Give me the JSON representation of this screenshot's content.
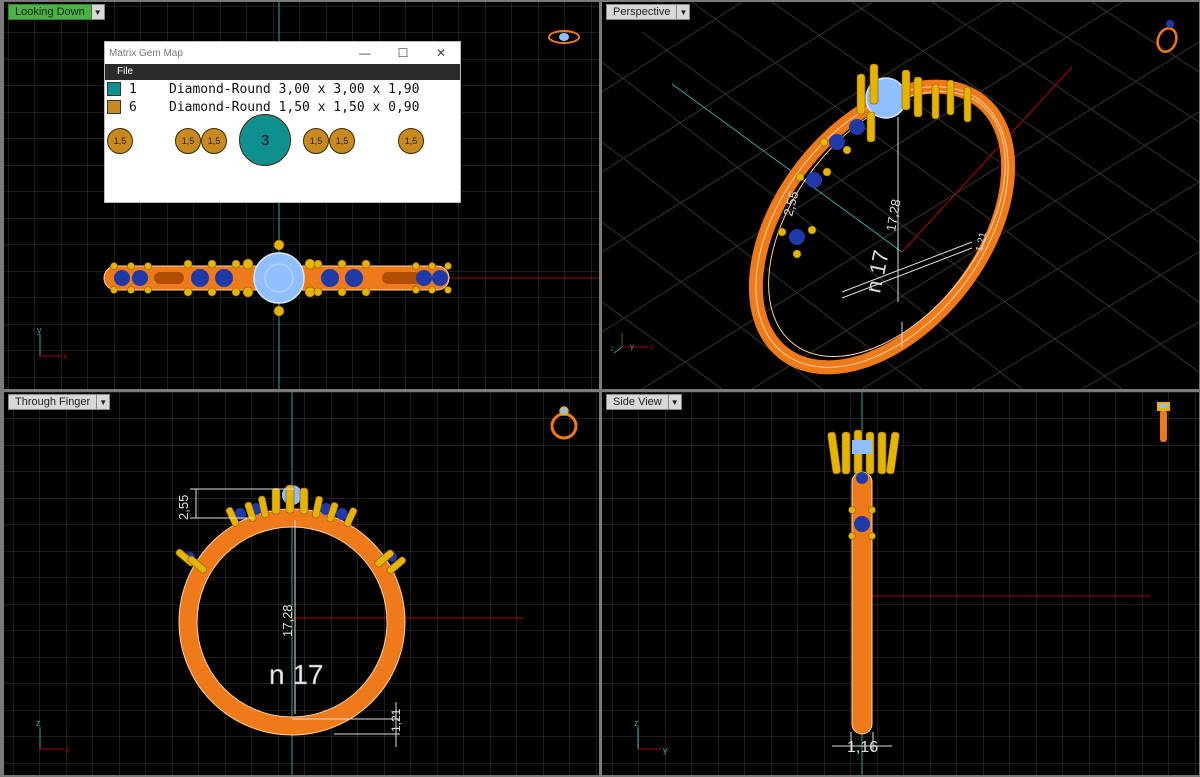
{
  "viewports": {
    "top_left": {
      "label": "Looking Down",
      "active": true
    },
    "top_right": {
      "label": "Perspective",
      "active": false
    },
    "bottom_left": {
      "label": "Through Finger",
      "active": false
    },
    "bottom_right": {
      "label": "Side View",
      "active": false
    }
  },
  "gem_map": {
    "title": "Matrix Gem Map",
    "menu_file": "File",
    "window_buttons": [
      "—",
      "☐",
      "✕"
    ],
    "rows": [
      {
        "color": "#0f8f8f",
        "count": "1",
        "desc": "Diamond-Round 3,00 x 3,00 x 1,90"
      },
      {
        "color": "#c88a1e",
        "count": "6",
        "desc": "Diamond-Round 1,50 x 1,50 x 0,90"
      }
    ],
    "small_label": "1,5",
    "large_label": "3"
  },
  "dims": {
    "perspective_height": "2,55",
    "perspective_inner": "17,28",
    "perspective_size": "n 17",
    "perspective_thickness": "1,21",
    "front_height": "2,55",
    "front_inner": "17,28",
    "front_size": "n 17",
    "front_thickness": "1,21",
    "side_width": "1,16"
  },
  "axes": {
    "x": "x",
    "y": "y",
    "z": "z"
  },
  "colors": {
    "metal": "#ee7a1a",
    "prong": "#e6b400",
    "center_stone": "#8fbfff",
    "side_stone": "#1f3aa8",
    "grid": "#3a3a3a",
    "axis_red": "#b00000",
    "axis_cyan": "#3aa0a0",
    "active_tab": "#4fb04a"
  }
}
